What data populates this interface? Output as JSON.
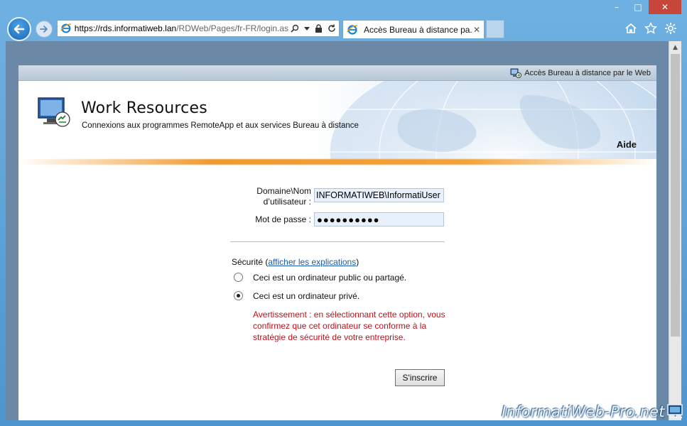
{
  "window": {
    "minimize": "–",
    "maximize": "□",
    "close": "✕"
  },
  "browser": {
    "url_host": "https://rds.informatiweb.lan",
    "url_path": "/RDWeb/Pages/fr-FR/login.as",
    "tab_title": "Accès Bureau à distance pa...",
    "icons": [
      "home-icon",
      "favorites-star-icon",
      "settings-gear-icon"
    ]
  },
  "page": {
    "top_strip_label": "Accès Bureau à distance par le Web",
    "title": "Work Resources",
    "subtitle": "Connexions aux programmes RemoteApp et aux services Bureau à distance",
    "help": "Aide"
  },
  "form": {
    "domain_label": "Domaine\\Nom d’utilisateur :",
    "domain_value": "INFORMATIWEB\\InformatiUser",
    "password_label": "Mot de passe :",
    "password_mask": "●●●●●●●●●●",
    "security_prefix": "Sécurité (",
    "security_link": "afficher les explications",
    "security_suffix": ")",
    "option_public": "Ceci est un ordinateur public ou partagé.",
    "option_private": "Ceci est un ordinateur privé.",
    "warning": "Avertissement : en sélectionnant cette option, vous confirmez que cet ordinateur se conforme à la stratégie de sécurité de votre entreprise.",
    "signin": "S'inscrire"
  },
  "watermark": "InformatiWeb-Pro.net",
  "colors": {
    "accent_orange": "#f19a30",
    "warning_red": "#c0101a",
    "link_blue": "#1a5ca8"
  }
}
